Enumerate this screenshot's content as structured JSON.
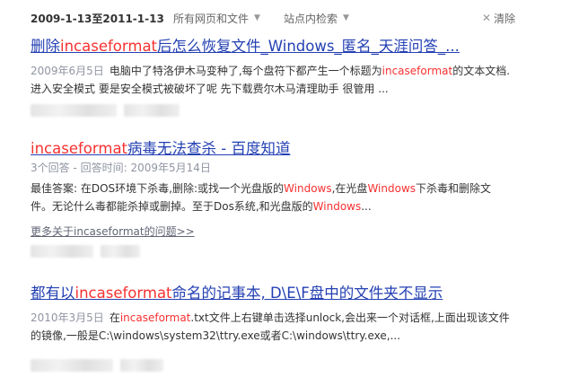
{
  "filters": {
    "time": "2009-1-13至2011-1-13",
    "scope": "所有网页和文件",
    "site": "站点内检索",
    "clear": "清除",
    "caret_icon": "caret-down-icon",
    "clear_icon": "close-icon"
  },
  "results": [
    {
      "title_parts": [
        "删除",
        "incaseformat",
        "后怎么恢复文件_Windows_匿名_天涯问答_..."
      ],
      "abstract": {
        "date": "2009年6月5日",
        "line1_parts": [
          "电脑中了特洛伊木马变种了,每个盘符下都产生一个标题为",
          "incaseformat",
          "的文本文档."
        ],
        "line2": "进入安全模式 要是安全模式被破坏了呢 先下载费尔木马清理助手 很管用 ..."
      }
    },
    {
      "title_parts": [
        "incaseformat",
        "病毒无法查杀 - 百度知道"
      ],
      "meta": "3个回答 - 回答时间: 2009年5月14日",
      "abstract": {
        "line1_parts": [
          "最佳答案: 在DOS环境下杀毒,删除:或找一个光盘版的",
          "Windows",
          ",在光盘",
          "Windows",
          "下杀毒和删除文"
        ],
        "line2_parts": [
          "件。无论什么毒都能杀掉或删掉。至于Dos系统,和光盘版的",
          "Windows",
          "..."
        ]
      },
      "more": "更多关于incaseformat的问题>>"
    },
    {
      "title_parts": [
        "都有以",
        "incaseformat",
        "命名的记事本, D\\E\\F盘中的文件夹不显示"
      ],
      "abstract": {
        "date": "2010年3月5日",
        "line1_parts": [
          "在",
          "incaseformat",
          ".txt文件上右键单击选择unlock,会出来一个对话框,上面出现该文件"
        ],
        "line2": "的镜像,一般是C:\\windows\\system32\\ttry.exe或者C:\\windows\\ttry.exe,..."
      }
    }
  ]
}
